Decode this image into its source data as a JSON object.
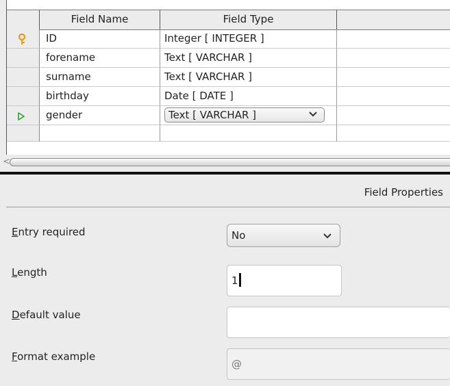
{
  "grid": {
    "headers": [
      "Field Name",
      "Field Type"
    ],
    "rows": [
      {
        "name": "ID",
        "type": "Integer [ INTEGER ]",
        "marker": "key-icon"
      },
      {
        "name": "forename",
        "type": "Text [ VARCHAR ]",
        "marker": ""
      },
      {
        "name": "surname",
        "type": "Text [ VARCHAR ]",
        "marker": ""
      },
      {
        "name": "birthday",
        "type": "Date [ DATE ]",
        "marker": ""
      },
      {
        "name": "gender",
        "type": "Text [ VARCHAR ]",
        "marker": "current-row-icon"
      }
    ]
  },
  "scrollbar": {
    "left_arrow": "<"
  },
  "properties": {
    "title": "Field Properties",
    "entry_required": {
      "mnemonic": "E",
      "rest": "ntry required",
      "value": "No"
    },
    "length": {
      "mnemonic": "L",
      "rest": "ength",
      "value": "1"
    },
    "default_value": {
      "mnemonic": "D",
      "rest": "efault value",
      "value": ""
    },
    "format_example": {
      "mnemonic": "F",
      "rest": "ormat example",
      "value": "@"
    }
  },
  "colors": {
    "key_icon": "#e3a21a",
    "current_row_icon": "#3caa3c",
    "divider": "#111111"
  }
}
